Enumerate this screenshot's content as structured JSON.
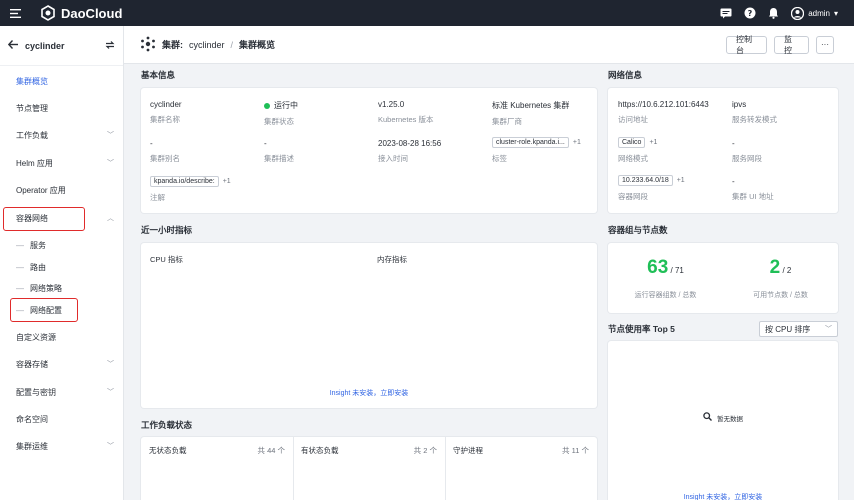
{
  "topbar": {
    "brand": "DaoCloud",
    "user": "admin"
  },
  "sidebar": {
    "cluster": "cyclinder",
    "items": [
      {
        "label": "集群概览",
        "active": true,
        "chevron": false
      },
      {
        "label": "节点管理",
        "chevron": false
      },
      {
        "label": "工作负载",
        "chevron": true
      },
      {
        "label": "Helm 应用",
        "chevron": true
      },
      {
        "label": "Operator 应用",
        "chevron": false
      },
      {
        "label": "容器网络",
        "chevron": true,
        "expanded": true
      },
      {
        "label": "服务",
        "sub": true
      },
      {
        "label": "路由",
        "sub": true
      },
      {
        "label": "网络策略",
        "sub": true
      },
      {
        "label": "网络配置",
        "sub": true
      },
      {
        "label": "自定义资源",
        "chevron": false
      },
      {
        "label": "容器存储",
        "chevron": true
      },
      {
        "label": "配置与密钥",
        "chevron": true
      },
      {
        "label": "命名空间",
        "chevron": false
      },
      {
        "label": "集群运维",
        "chevron": true
      }
    ]
  },
  "header": {
    "prefix": "集群:",
    "cluster": "cyclinder",
    "separator": "/",
    "page": "集群概览",
    "buttons": {
      "console": "控制台",
      "monitor": "监控",
      "more": "···"
    }
  },
  "basic": {
    "title": "基本信息",
    "fields": {
      "name": {
        "value": "cyclinder",
        "label": "集群名称"
      },
      "status": {
        "value": "运行中",
        "label": "集群状态"
      },
      "version": {
        "value": "v1.25.0",
        "label": "Kubernetes 版本"
      },
      "vendor": {
        "value": "标准 Kubernetes 集群",
        "label": "集群厂商"
      },
      "alias": {
        "value": "-",
        "label": "集群别名"
      },
      "desc": {
        "value": "-",
        "label": "集群描述"
      },
      "joined": {
        "value": "2023-08-28 16:56",
        "label": "接入时间"
      },
      "labels": {
        "tag": "cluster-role.kpanda.i...",
        "more": "+1",
        "label": "标签"
      },
      "annotations": {
        "tag": "kpanda.io/describe:",
        "more": "+1",
        "label": "注解"
      }
    }
  },
  "network": {
    "title": "网络信息",
    "fields": {
      "address": {
        "value": "https://10.6.212.101:6443",
        "label": "访问地址"
      },
      "proxy": {
        "value": "ipvs",
        "label": "服务转发模式"
      },
      "mode": {
        "tag": "Calico",
        "more": "+1",
        "label": "网络模式"
      },
      "svc_cidr": {
        "value": "-",
        "label": "服务网段"
      },
      "pod_cidr": {
        "tag": "10.233.64.0/18",
        "more": "+1",
        "label": "容器网段"
      },
      "svc_ui": {
        "value": "-",
        "label": "集群 UI 地址"
      }
    }
  },
  "metrics": {
    "title": "近一小时指标",
    "cpu": "CPU 指标",
    "mem": "内存指标",
    "notice": "Insight 未安装，立即安装"
  },
  "pods": {
    "title": "容器组与节点数",
    "pod_running": "63",
    "pod_total": "/ 71",
    "pod_label": "运行容器组数 / 总数",
    "node_ready": "2",
    "node_total": "/ 2",
    "node_label": "可用节点数 / 总数"
  },
  "top5": {
    "title": "节点使用率 Top 5",
    "sort": "按 CPU 排序",
    "empty": "暂无数据",
    "notice": "Insight 未安装，立即安装"
  },
  "workload": {
    "title": "工作负载状态",
    "cols": [
      {
        "label": "无状态负载",
        "count": "共 44 个"
      },
      {
        "label": "有状态负载",
        "count": "共 2 个"
      },
      {
        "label": "守护进程",
        "count": "共 11 个"
      }
    ]
  },
  "colors": {
    "accent": "#3064e3",
    "success": "#1fbf57",
    "highlight": "#e02b2b",
    "topbar": "#1f2530"
  }
}
